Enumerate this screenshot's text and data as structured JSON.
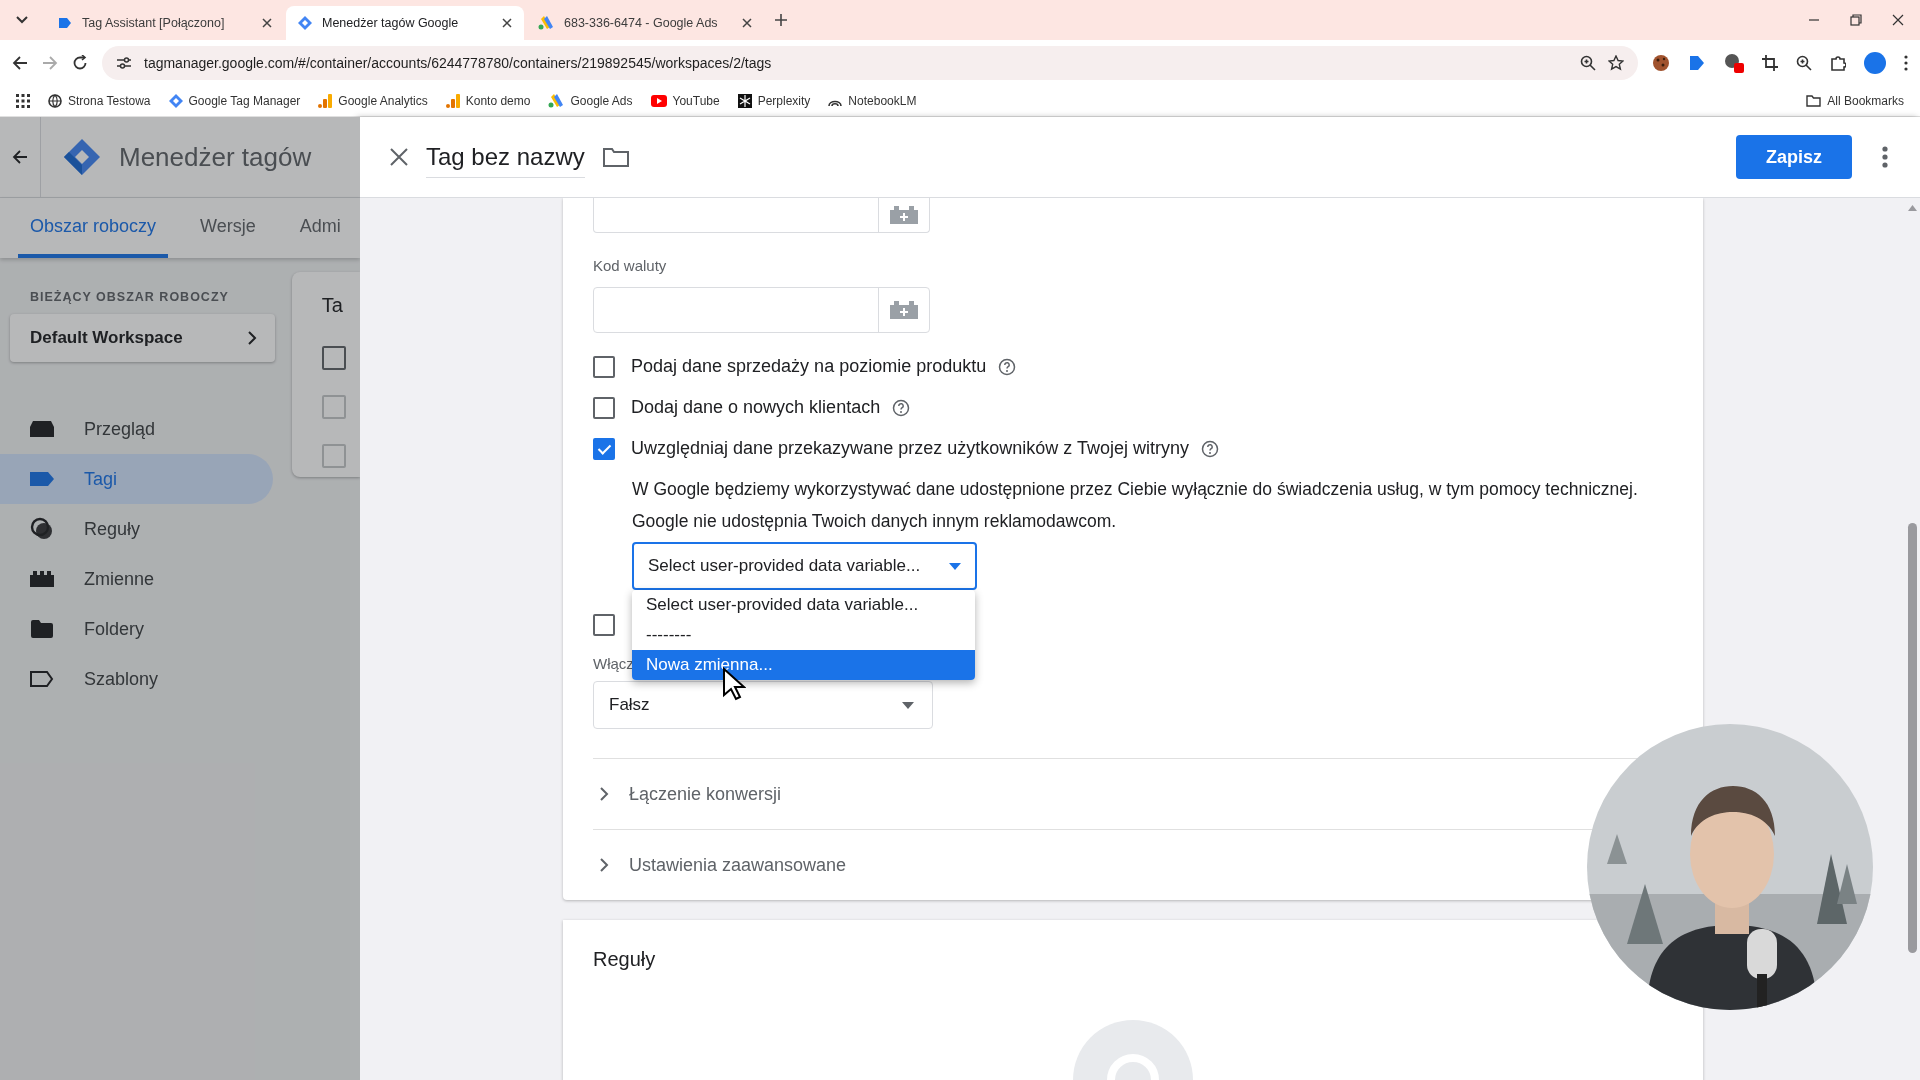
{
  "browser": {
    "tabs": [
      {
        "title": "Tag Assistant [Połączono]",
        "selected": false
      },
      {
        "title": "Menedżer tagów Google",
        "selected": true
      },
      {
        "title": "683-336-6474 - Google Ads",
        "selected": false
      }
    ],
    "url": "tagmanager.google.com/#/container/accounts/6244778780/containers/219892545/workspaces/2/tags",
    "bookmarks": [
      "Strona Testowa",
      "Google Tag Manager",
      "Google Analytics",
      "Konto demo",
      "Google Ads",
      "YouTube",
      "Perplexity",
      "NotebookLM"
    ],
    "all_bookmarks": "All Bookmarks"
  },
  "app": {
    "title": "Menedżer tagów",
    "nav_tabs": [
      {
        "label": "Obszar roboczy",
        "selected": true
      },
      {
        "label": "Wersje",
        "selected": false
      },
      {
        "label": "Admi",
        "selected": false
      }
    ],
    "workspace_heading": "BIEŻĄCY OBSZAR ROBOCZY",
    "workspace": "Default Workspace",
    "sidebar": [
      {
        "label": "Przegląd",
        "selected": false
      },
      {
        "label": "Tagi",
        "selected": true
      },
      {
        "label": "Reguły",
        "selected": false
      },
      {
        "label": "Zmienne",
        "selected": false
      },
      {
        "label": "Foldery",
        "selected": false
      },
      {
        "label": "Szablony",
        "selected": false
      }
    ],
    "list_title": "Ta",
    "list_checkboxes": [
      {
        "checked": false
      },
      {
        "checked": false
      },
      {
        "checked": false
      }
    ]
  },
  "editor": {
    "title": "Tag bez nazwy",
    "save": "Zapisz",
    "currency_label": "Kod waluty",
    "checkboxes": [
      {
        "label": "Podaj dane sprzedaży na poziomie produktu",
        "checked": false
      },
      {
        "label": "Dodaj dane o nowych klientach",
        "checked": false
      },
      {
        "label": "Uwzględniaj dane przekazywane przez użytkowników z Twojej witryny",
        "checked": true
      }
    ],
    "notice": [
      "W Google będziemy wykorzystywać dane udostępnione przez Ciebie wyłącznie do świadczenia usług, w tym pomocy technicznej.",
      "Google nie udostępnia Twoich danych innym reklamodawcom."
    ],
    "select": {
      "value": "Select user-provided data variable...",
      "options": [
        {
          "label": "Select user-provided data variable...",
          "highlighted": false
        },
        {
          "label": "--------",
          "highlighted": false
        },
        {
          "label": "Nowa zmienna...",
          "highlighted": true
        }
      ]
    },
    "covered_checkbox": {
      "checked": false
    },
    "enable_label": "Włącz",
    "enable_value": "Fałsz",
    "sections": [
      "Łączenie konwersji",
      "Ustawienia zaawansowane"
    ],
    "rules_title": "Reguły"
  }
}
